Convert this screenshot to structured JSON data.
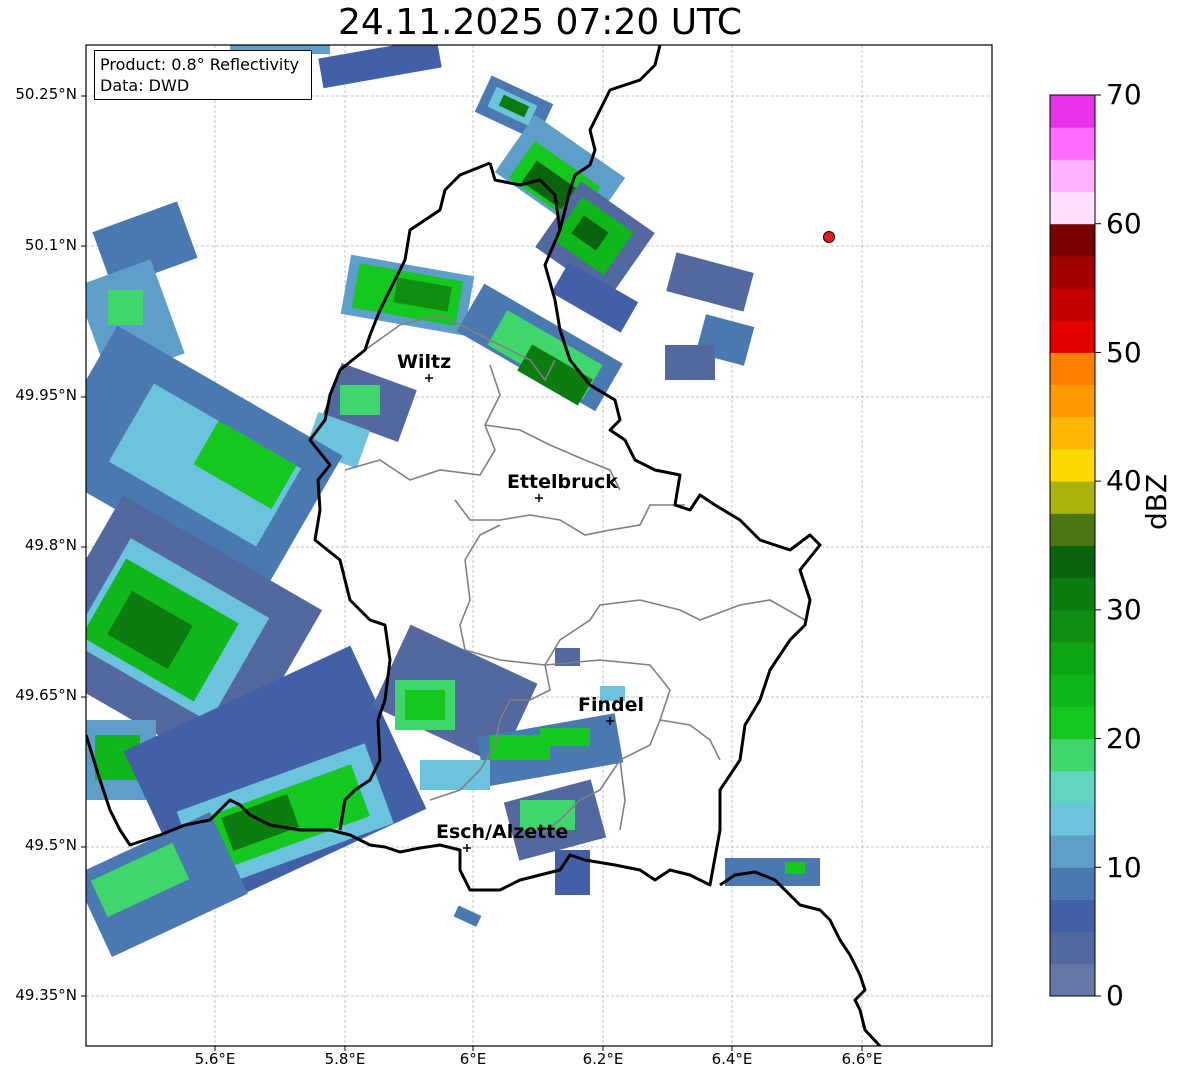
{
  "title": "24.11.2025 07:20 UTC",
  "info": {
    "product": "Product: 0.8° Reflectivity",
    "data": "Data: DWD"
  },
  "axes": {
    "lat_ticks": [
      "50.25°N",
      "50.1°N",
      "49.95°N",
      "49.8°N",
      "49.65°N",
      "49.5°N",
      "49.35°N"
    ],
    "lon_ticks": [
      "5.6°E",
      "5.8°E",
      "6°E",
      "6.2°E",
      "6.4°E",
      "6.6°E"
    ],
    "grid": true
  },
  "cities": [
    {
      "name": "Wiltz"
    },
    {
      "name": "Ettelbruck"
    },
    {
      "name": "Findel"
    },
    {
      "name": "Esch/Alzette"
    }
  ],
  "marker": {
    "type": "red-dot",
    "color": "#e8191b"
  },
  "colorbar": {
    "label": "dBZ",
    "min": 0,
    "max": 70,
    "ticks": [
      "0",
      "10",
      "20",
      "30",
      "40",
      "50",
      "60",
      "70"
    ],
    "colors": [
      "#6577a8",
      "#52689e",
      "#4260a6",
      "#4a78b0",
      "#5e9ec8",
      "#6bc3dd",
      "#5fd5c2",
      "#3fd66d",
      "#14c81f",
      "#10b71a",
      "#0fa616",
      "#0e8f12",
      "#0c7c10",
      "#0a640e",
      "#4c7612",
      "#a9b30a",
      "#ffd800",
      "#fdb706",
      "#ff9b00",
      "#ff7f00",
      "#e30000",
      "#c30000",
      "#a00000",
      "#780000",
      "#ffe0ff",
      "#ffb2ff",
      "#ff6cff",
      "#e832e8"
    ]
  }
}
